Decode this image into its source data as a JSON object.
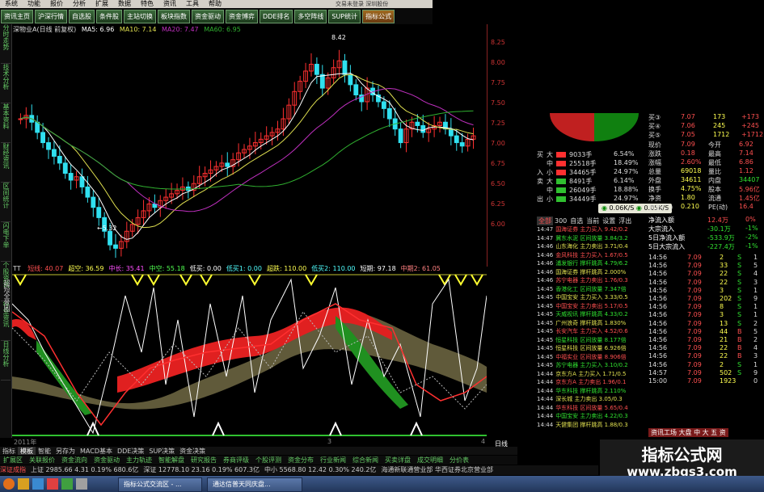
{
  "menu": [
    "系统",
    "功能",
    "报价",
    "分析",
    "扩展",
    "数据",
    "特色",
    "资讯",
    "工具",
    "帮助"
  ],
  "window_title": "交易未登录  深圳股份",
  "toolbar_tabs": [
    "资讯主页",
    "沪深行情",
    "自选股",
    "条件股",
    "主站切换",
    "板块指数",
    "资金驱动",
    "资金博弈",
    "DDE排名",
    "多空阵线",
    "SUP统计",
    "指标公式"
  ],
  "left_vertical_tabs": [
    "分时走势",
    "技术分析",
    "基本资料",
    "财经资讯",
    "区间统计",
    "闪电下单",
    "个股资讯",
    "行业资讯",
    "日线分析"
  ],
  "kline": {
    "legend_stock": "深物业A(日线 前复权)",
    "ma5": "MA5: 6.96",
    "ma10": "MA10: 7.14",
    "ma20": "MA20: 7.47",
    "ma60": "MA60: 6.95",
    "high_label": "8.42",
    "low_label": "5.32",
    "price_ticks": [
      "8.25",
      "8.00",
      "7.75",
      "7.50",
      "7.25",
      "7.00",
      "6.75",
      "6.50",
      "6.25",
      "6.00"
    ],
    "colors": {
      "up": "#ff3030",
      "down": "#30e0f0",
      "ma5": "#ffffff",
      "ma10": "#e0e050",
      "ma20": "#c030c0",
      "ma60": "#30b030"
    }
  },
  "indicator": {
    "name": "TT",
    "items": [
      "短线: 40.07",
      "超空: 36.59",
      "中长: 35.41",
      "中空: 55.18",
      "低买: 0.00",
      "低买1: 0.00",
      "超跌: 110.00",
      "低买2: 110.00",
      "短期: 97.18",
      "中期2: 61.05"
    ],
    "side_label": "超短全景图"
  },
  "time_axis": {
    "year": "2011年",
    "months": [
      "3",
      "4"
    ],
    "period": "日线"
  },
  "bottom_tabs": [
    "指标",
    "模板",
    "智能",
    "另存为",
    "MACD基本",
    "DDE决策",
    "SUP决策",
    "资金决策"
  ],
  "nav_tabs": [
    "扩展区",
    "关联报价",
    "资金流向",
    "资金驱动",
    "主力轨迹",
    "智能解盘",
    "研究报告",
    "券商评级",
    "个股评测",
    "资金分布",
    "行业新闻",
    "综合新闻",
    "买卖详盘",
    "成交明细",
    "分价表"
  ],
  "status_bar": [
    "深证成指",
    "上证 2985.66  4.31  0.19%  680.6亿",
    "深证 12778.10  23.16  0.19%  607.3亿",
    "中小 5568.80  12.42  0.30%  240.2亿",
    "海通新联通营业部  华西证券北京营业部"
  ],
  "taskbar": [
    "指标公式交流区 - ...",
    "通达信普天同庆盘..."
  ],
  "brand": {
    "name": "指标公式网",
    "url": "www.zbgs3.com"
  },
  "right_panel": {
    "tabs": [
      "全部",
      "300",
      "自选",
      "当前",
      "设置",
      "浮出"
    ],
    "order_queue": [
      {
        "label": "买③",
        "price": "7.07",
        "vol": "173",
        "chg": "+173"
      },
      {
        "label": "买④",
        "price": "7.06",
        "vol": "245",
        "chg": "+245"
      },
      {
        "label": "买⑤",
        "price": "7.05",
        "vol": "1712",
        "chg": "+1712"
      }
    ],
    "quotes": [
      {
        "l1": "现价",
        "v1": "7.09",
        "l2": "今开",
        "v2": "6.92"
      },
      {
        "l1": "涨跌",
        "v1": "0.18",
        "l2": "最高",
        "v2": "7.14"
      },
      {
        "l1": "涨幅",
        "v1": "2.60%",
        "l2": "最低",
        "v2": "6.86"
      },
      {
        "l1": "总量",
        "v1": "69018",
        "l2": "量比",
        "v2": "1.12"
      },
      {
        "l1": "外盘",
        "v1": "34611",
        "l2": "内盘",
        "v2": "34407"
      },
      {
        "l1": "换手",
        "v1": "4.75%",
        "l2": "股本",
        "v2": "5.96亿"
      },
      {
        "l1": "净资",
        "v1": "1.80",
        "l2": "流通",
        "v2": "1.45亿"
      },
      {
        "l1": "收益(二)",
        "v1": "0.210",
        "l2": "PE(动)",
        "v2": "16.4"
      }
    ],
    "big_orders": [
      {
        "side": "买",
        "size": "大",
        "vol": "9033手",
        "pct": "6.54%",
        "color": "#ff3030"
      },
      {
        "side": "",
        "size": "中",
        "vol": "25518手",
        "pct": "18.49%",
        "color": "#ff3030"
      },
      {
        "side": "入",
        "size": "小",
        "vol": "34465手",
        "pct": "24.97%",
        "color": "#ff3030"
      },
      {
        "side": "卖",
        "size": "大",
        "vol": "8491手",
        "pct": "6.14%",
        "color": "#30c030"
      },
      {
        "side": "",
        "size": "中",
        "vol": "26049手",
        "pct": "18.88%",
        "color": "#30c030"
      },
      {
        "side": "出",
        "size": "小",
        "vol": "34449手",
        "pct": "24.97%",
        "color": "#30c030"
      }
    ],
    "speed": [
      "0.06K/S",
      "0.05K/S"
    ],
    "flows": [
      {
        "label": "净流入额",
        "value": "12.4万",
        "pct": "0%"
      },
      {
        "label": "大宗流入",
        "value": "-30.1万",
        "pct": "-1%"
      },
      {
        "label": "5日净流入额",
        "value": "-533.9万",
        "pct": "-2%"
      },
      {
        "label": "5日大宗流入",
        "value": "-227.4万",
        "pct": "-1%"
      }
    ],
    "trades": [
      {
        "time": "14:47",
        "text": "国海证券  主力买入  9.42/0.2"
      },
      {
        "time": "14:47",
        "text": "冀东水泥  区间放量  3.84/3.2"
      },
      {
        "time": "14:46",
        "text": "山东海化  主力卖出  3.71/0.4"
      },
      {
        "time": "14:46",
        "text": "金风科技  主力买入  1.67/0.5"
      },
      {
        "time": "14:46",
        "text": "浦发银行  撑杆跳高  4.79/6.2"
      },
      {
        "time": "14:46",
        "text": "国海证券  撑杆跳高  2.000%"
      },
      {
        "time": "14:46",
        "text": "苏宁电器  主力卖出  1.76/0.3"
      },
      {
        "time": "14:45",
        "text": "香港化工  区间放量  7.347倍"
      },
      {
        "time": "14:45",
        "text": "中国宝安  主力买入  3.33/0.5"
      },
      {
        "time": "14:45",
        "text": "中国宝安  主力卖出  5.17/0.5"
      },
      {
        "time": "14:45",
        "text": "天威视讯  撑杆跳高  4.33/0.2"
      },
      {
        "time": "14:45",
        "text": "广州浪奇  撑杆跳高  1.830%"
      },
      {
        "time": "14:45",
        "text": "长安汽车  主力买入  4.52/0.6"
      },
      {
        "time": "14:45",
        "text": "恒星科技  区间放量  8.177倍"
      },
      {
        "time": "14:45",
        "text": "恒星科技  区间放量  6.926倍"
      },
      {
        "time": "14:45",
        "text": "中福实业  区间放量  8.906倍"
      },
      {
        "time": "14:45",
        "text": "苏宁电器  主力买入  3.10/0.2"
      },
      {
        "time": "14:44",
        "text": "京东方A  主力买入  1.71/0.5"
      },
      {
        "time": "14:44",
        "text": "京东方A  主力卖出  1.96/0.1"
      },
      {
        "time": "14:44",
        "text": "华东科技  撑杆跳高  2.110%"
      },
      {
        "time": "14:44",
        "text": "深长城  主力卖出  3.05/0.3"
      },
      {
        "time": "14:44",
        "text": "华东科技  区间放量  5.65/0.4"
      },
      {
        "time": "14:44",
        "text": "中国宝安  主力卖出  4.22/0.3"
      },
      {
        "time": "14:44",
        "text": "天健集团  撑杆跳高  1.88/0.3"
      },
      {
        "time": "14:43",
        "text": "中航地产  区间放量  7.200倍"
      },
      {
        "time": "14:43",
        "text": "天威视讯  区间放量  1.550%"
      },
      {
        "time": "14:43",
        "text": "天津普林  撑杆跳高  2.101%"
      },
      {
        "time": "14:43",
        "text": "大族激光  撑杆跳高  1.870%"
      },
      {
        "time": "14:43",
        "text": "华东电子  撑杆跳高  1.660%"
      },
      {
        "time": "14:42",
        "text": "苏宁电器  主力卖出  1.90/0.1"
      },
      {
        "time": "14:42",
        "text": "丽珠集团  撑杆跳高  1.87/0.2"
      }
    ],
    "ticks": [
      {
        "time": "14:56",
        "price": "7.09",
        "vol": "2",
        "bs": "S",
        "n": "1"
      },
      {
        "time": "14:56",
        "price": "7.09",
        "vol": "33",
        "bs": "S",
        "n": "5"
      },
      {
        "time": "14:56",
        "price": "7.09",
        "vol": "22",
        "bs": "S",
        "n": "4"
      },
      {
        "time": "14:56",
        "price": "7.09",
        "vol": "22",
        "bs": "S",
        "n": "3"
      },
      {
        "time": "14:56",
        "price": "7.09",
        "vol": "3",
        "bs": "S",
        "n": "1"
      },
      {
        "time": "14:56",
        "price": "7.09",
        "vol": "202",
        "bs": "S",
        "n": "9"
      },
      {
        "time": "14:56",
        "price": "7.09",
        "vol": "8",
        "bs": "S",
        "n": "1"
      },
      {
        "time": "14:56",
        "price": "7.09",
        "vol": "3",
        "bs": "S",
        "n": "1"
      },
      {
        "time": "14:56",
        "price": "7.09",
        "vol": "13",
        "bs": "S",
        "n": "2"
      },
      {
        "time": "14:56",
        "price": "7.09",
        "vol": "44",
        "bs": "B",
        "n": "5"
      },
      {
        "time": "14:56",
        "price": "7.09",
        "vol": "21",
        "bs": "B",
        "n": "2"
      },
      {
        "time": "14:56",
        "price": "7.09",
        "vol": "22",
        "bs": "B",
        "n": "4"
      },
      {
        "time": "14:56",
        "price": "7.09",
        "vol": "22",
        "bs": "B",
        "n": "3"
      },
      {
        "time": "14:56",
        "price": "7.09",
        "vol": "2",
        "bs": "S",
        "n": "1"
      },
      {
        "time": "14:57",
        "price": "7.09",
        "vol": "502",
        "bs": "S",
        "n": "9"
      },
      {
        "time": "15:00",
        "price": "7.09",
        "vol": "1923",
        "bs": "",
        "n": "0"
      }
    ],
    "bottom_label": "资讯工场  大盘  中  大  五  资"
  }
}
